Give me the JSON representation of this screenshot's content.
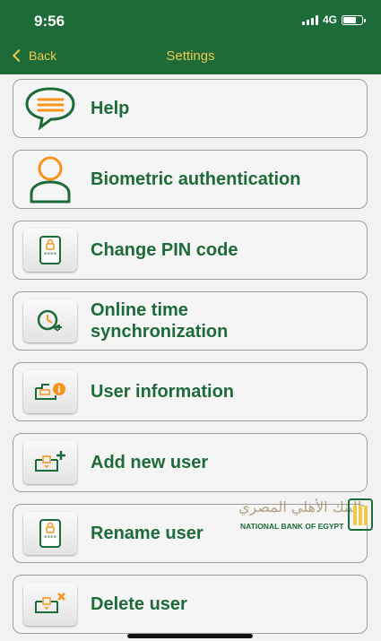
{
  "status_bar": {
    "time": "9:56",
    "network": "4G"
  },
  "nav": {
    "back_label": "Back",
    "title": "Settings"
  },
  "menu": [
    {
      "label": "Help",
      "icon": "chat-bubble-icon"
    },
    {
      "label": "Biometric authentication",
      "icon": "person-icon"
    },
    {
      "label": "Change PIN code",
      "icon": "tablet-pin-icon"
    },
    {
      "label": "Online time\nsynchronization",
      "icon": "clock-sync-icon"
    },
    {
      "label": "User information",
      "icon": "user-info-icon"
    },
    {
      "label": "Add new user",
      "icon": "add-user-icon"
    },
    {
      "label": "Rename user",
      "icon": "tablet-pin-icon"
    },
    {
      "label": "Delete user",
      "icon": "delete-user-icon"
    }
  ],
  "brand": {
    "name_ar": "البنك الأهلي المصري",
    "name_en": "NATIONAL BANK OF EGYPT"
  },
  "colors": {
    "brand_green": "#1d6b39",
    "accent_gold": "#f0c94a",
    "icon_orange": "#f7941d"
  }
}
